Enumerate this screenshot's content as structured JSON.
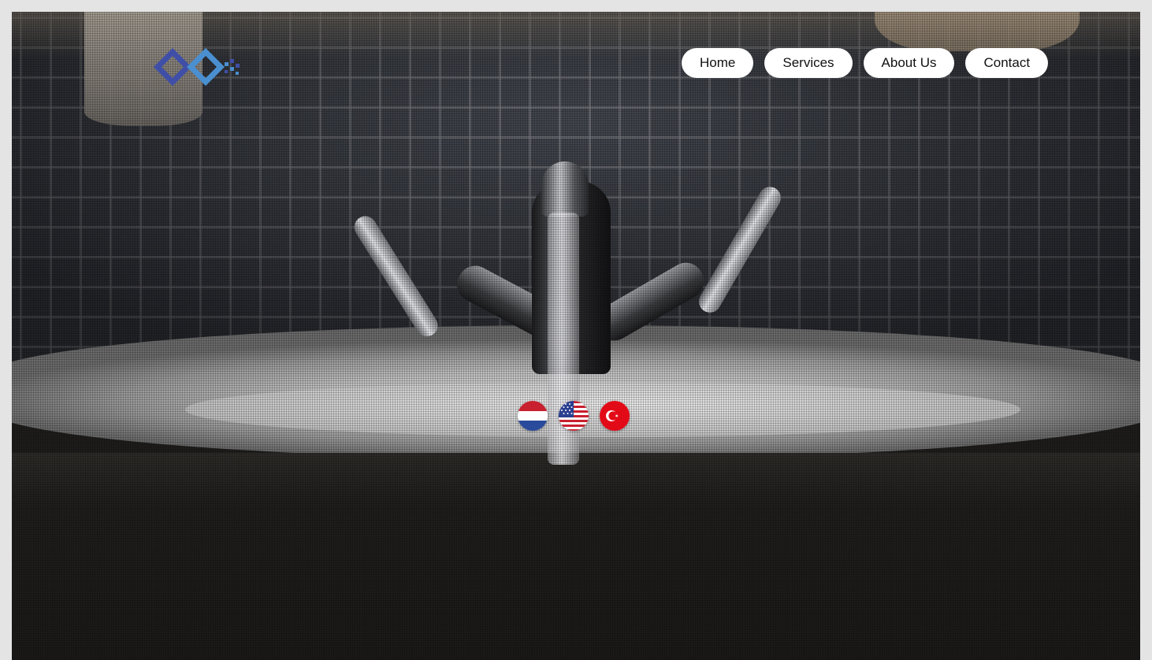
{
  "nav": {
    "items": [
      {
        "label": "Home"
      },
      {
        "label": "Services"
      },
      {
        "label": "About Us"
      },
      {
        "label": "Contact"
      }
    ]
  },
  "logo": {
    "icon": "diamond-logo-icon",
    "colors": {
      "dark": "#3f4fa8",
      "light": "#4a8fd0"
    }
  },
  "hero": {
    "background": "bathroom-sink-faucet-photo"
  },
  "languages": [
    {
      "code": "nl",
      "icon": "netherlands-flag-icon"
    },
    {
      "code": "en",
      "icon": "usa-flag-icon"
    },
    {
      "code": "tr",
      "icon": "turkey-flag-icon"
    }
  ],
  "colors": {
    "nav_bg": "#ffffff",
    "nav_text": "#111111",
    "dark_bg": "#1e1d1b"
  }
}
